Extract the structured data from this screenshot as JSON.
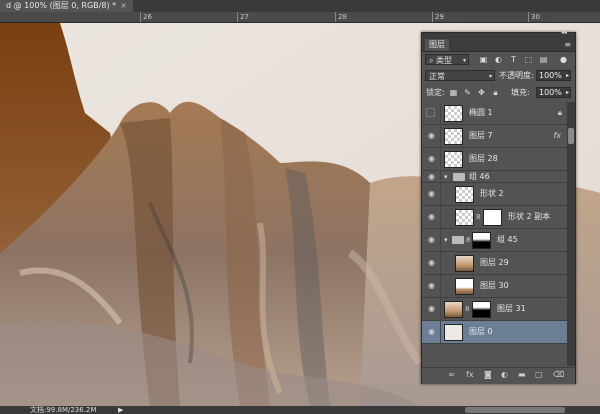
{
  "document_tab": {
    "title": "d @ 100% (图层 0, RGB/8) *",
    "close": "×"
  },
  "ruler": {
    "ticks": [
      "26",
      "27",
      "28",
      "29",
      "30"
    ]
  },
  "layers_panel": {
    "tab_label": "图层",
    "collapse_glyph": "◂◂",
    "close_glyph": "×",
    "menu_glyph": "≡",
    "filter_type": "类型",
    "blend_mode": "正常",
    "opacity_label": "不透明度:",
    "opacity_value": "100%",
    "lock_label": "锁定:",
    "fill_label": "填充:",
    "fill_value": "100%",
    "layers": [
      {
        "name": "椭圆 1",
        "visible": false,
        "locked": true
      },
      {
        "name": "图层 7",
        "visible": true,
        "fx": "fx"
      },
      {
        "name": "图层 28",
        "visible": true
      },
      {
        "name": "组 46",
        "visible": true,
        "group": true
      },
      {
        "name": "形状 2",
        "visible": true
      },
      {
        "name": "形状 2 副本",
        "visible": true
      },
      {
        "name": "组 45",
        "visible": true,
        "group": true
      },
      {
        "name": "图层 29",
        "visible": true
      },
      {
        "name": "图层 30",
        "visible": true
      },
      {
        "name": "图层 31",
        "visible": true
      },
      {
        "name": "图层 0",
        "visible": true,
        "selected": true
      }
    ]
  },
  "status_bar": {
    "doc_info": "文档:99.8M/236.2M",
    "arrow": "▶"
  },
  "colors": {
    "panel_bg": "#535353",
    "selected_layer": "#6b7e95",
    "canvas_bg": "#e8e1da"
  }
}
